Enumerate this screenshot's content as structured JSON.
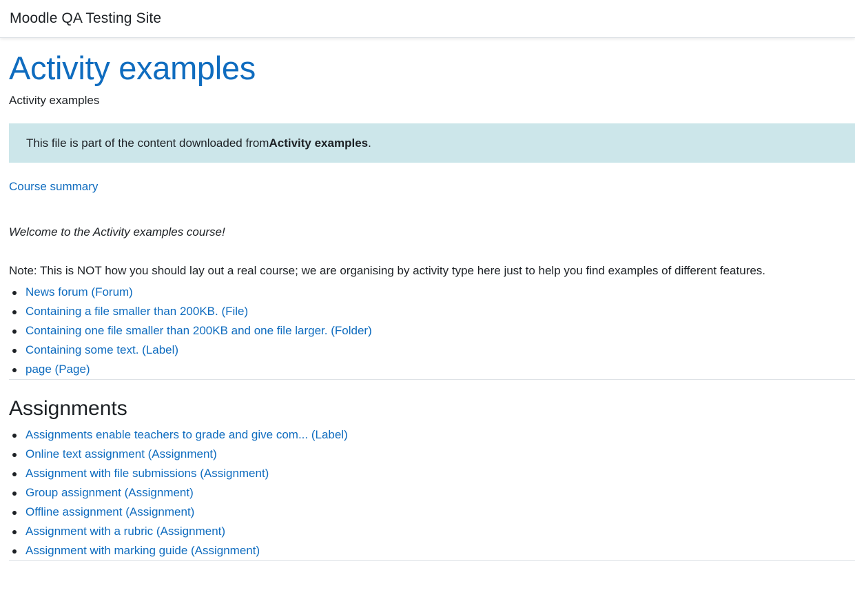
{
  "navbar": {
    "site_name": "Moodle QA Testing Site"
  },
  "page": {
    "title": "Activity examples",
    "subtitle": "Activity examples"
  },
  "alert": {
    "prefix": "This file is part of the content downloaded from ",
    "course_name": "Activity examples",
    "suffix": "."
  },
  "summary": {
    "link_label": "Course summary",
    "welcome": "Welcome to the Activity examples course!",
    "note": "Note: This is NOT how you should lay out a real course; we are organising by activity type here just to help you find examples of different features."
  },
  "general_items": [
    "News forum (Forum)",
    "Containing a file smaller than 200KB. (File)",
    "Containing one file smaller than 200KB and one file larger. (Folder)",
    "Containing some text. (Label)",
    "page (Page)"
  ],
  "assignments": {
    "title": "Assignments",
    "items": [
      "Assignments enable teachers to grade and give com... (Label)",
      "Online text assignment (Assignment)",
      "Assignment with file submissions (Assignment)",
      "Group assignment (Assignment)",
      "Offline assignment (Assignment)",
      "Assignment with a rubric (Assignment)",
      "Assignment with marking guide (Assignment)"
    ]
  },
  "colors": {
    "link": "#0f6cbf",
    "alert_bg": "#cce6ea",
    "text": "#1d2125"
  }
}
